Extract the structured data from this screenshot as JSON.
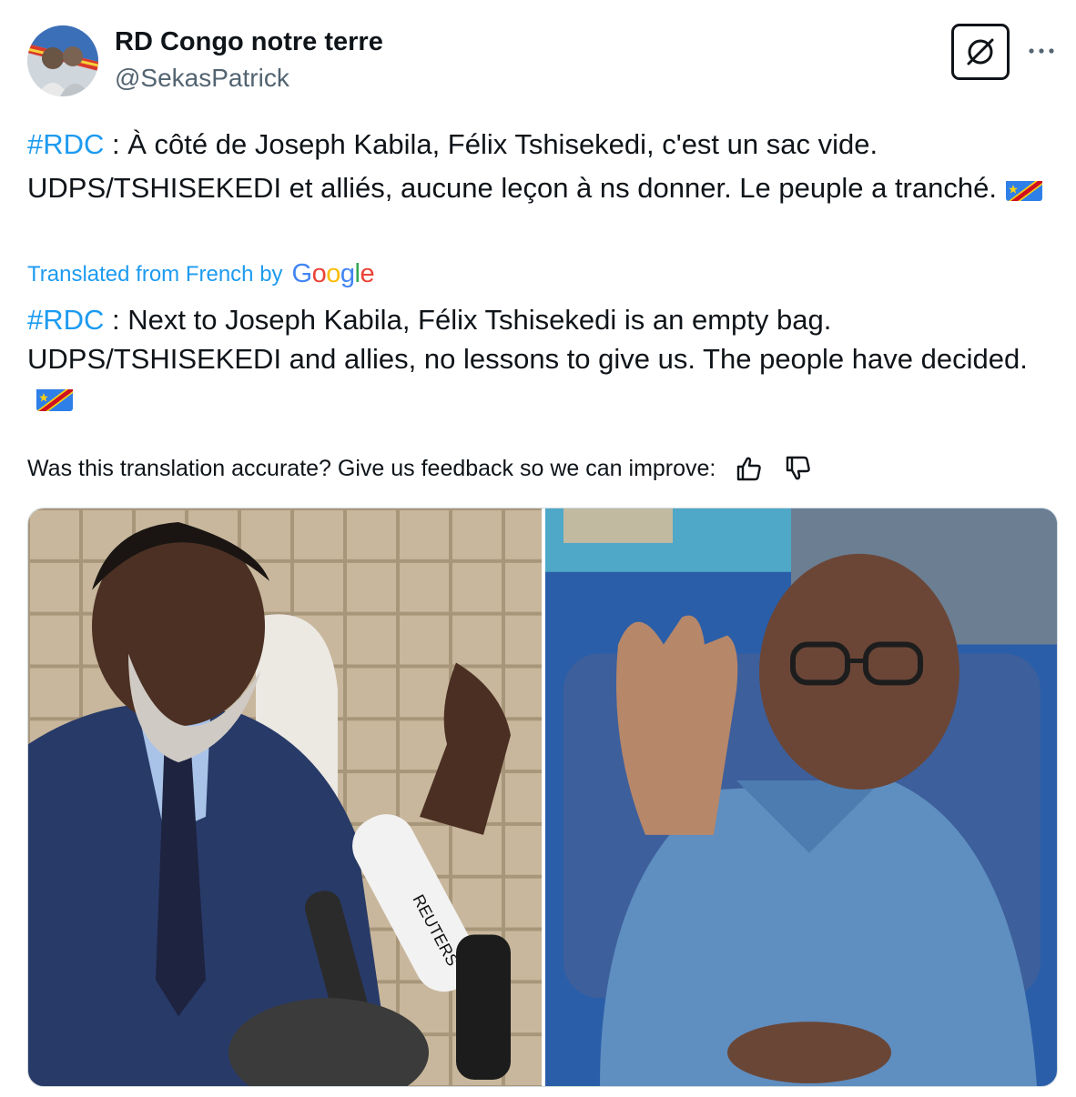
{
  "author": {
    "display_name": "RD Congo notre terre",
    "handle": "@SekasPatrick",
    "avatar_icon": "profile-avatar"
  },
  "header_actions": {
    "grok_icon": "grok-icon",
    "more_icon": "more-options-icon"
  },
  "tweet": {
    "original": {
      "hashtag": "#RDC",
      "text": " : À côté de Joseph Kabila, Félix Tshisekedi, c'est un sac vide. UDPS/TSHISEKEDI et alliés, aucune leçon à ns donner. Le peuple a tranché."
    },
    "translation_label": "Translated from French by",
    "translation_logo_text": "Google",
    "translated": {
      "hashtag": "#RDC",
      "text": " : Next to Joseph Kabila, Félix Tshisekedi is an empty bag. UDPS/TSHISEKEDI and allies, no lessons to give us. The people have decided."
    },
    "flag_emoji": "flag-drc-icon",
    "feedback_prompt": "Was this translation accurate? Give us feedback so we can improve:"
  },
  "media": {
    "photos": [
      {
        "name": "photo-kabila",
        "microphone_text": "REUTERS"
      },
      {
        "name": "photo-tshisekedi"
      }
    ]
  },
  "colors": {
    "link": "#1d9bf0",
    "text": "#0f1419",
    "secondary": "#536471",
    "border": "#cfd9de"
  }
}
